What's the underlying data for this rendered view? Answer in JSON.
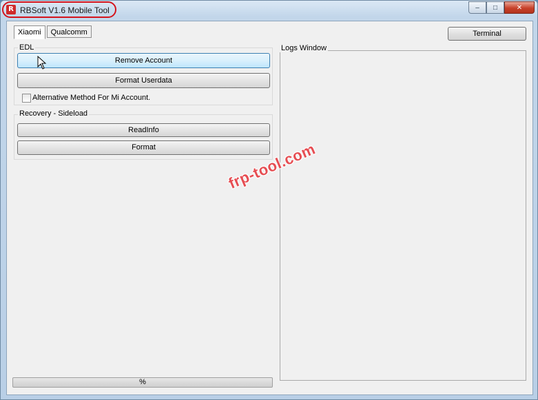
{
  "window": {
    "title": "RBSoft V1.6 Mobile Tool",
    "icon_letter": "R",
    "controls": {
      "minimize": "–",
      "maximize": "□",
      "close": "✕"
    }
  },
  "tabs": [
    {
      "label": "Xiaomi",
      "active": true
    },
    {
      "label": "Qualcomm",
      "active": false
    }
  ],
  "terminal_button": "Terminal",
  "edl": {
    "group_title": "EDL",
    "remove_account": "Remove Account",
    "format_userdata": "Format Userdata",
    "alt_method_label": "Alternative Method For Mi Account.",
    "alt_method_checked": false
  },
  "recovery": {
    "group_title": "Recovery - Sideload",
    "read_info": "ReadInfo",
    "format": "Format"
  },
  "logs": {
    "title": "Logs Window"
  },
  "progress": {
    "label": "%",
    "value": 0
  },
  "watermark": "frp-tool.com",
  "colors": {
    "highlight_ring": "#d4141c",
    "watermark": "#e6464b",
    "button_hover": "#bee6fd"
  }
}
